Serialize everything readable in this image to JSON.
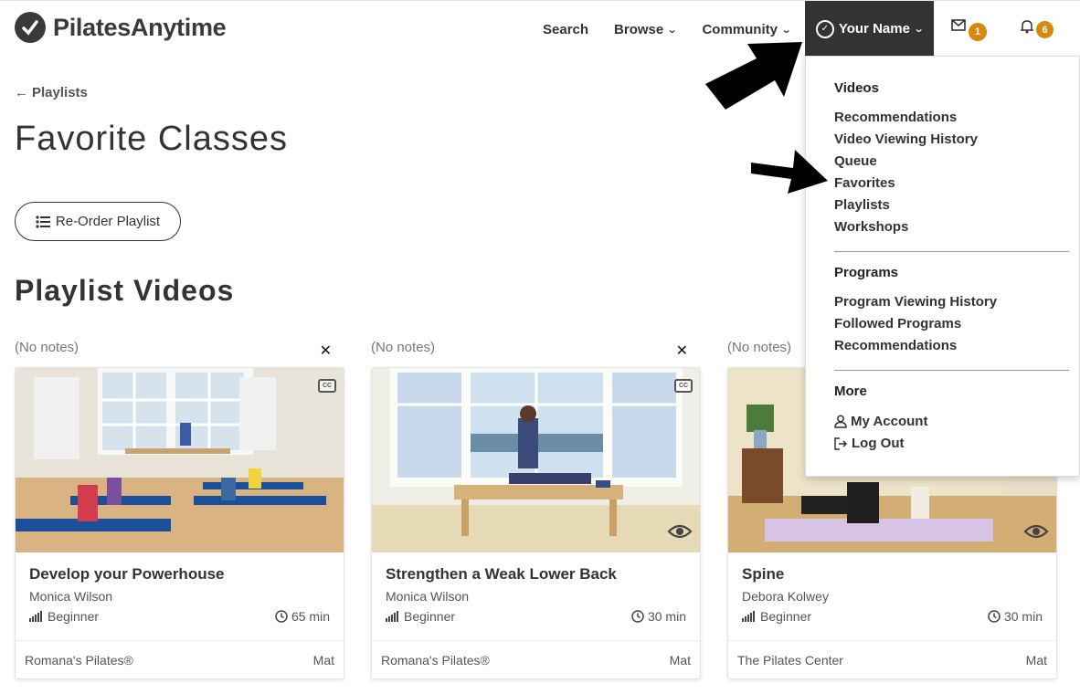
{
  "brand": {
    "name": "PilatesAnytime"
  },
  "nav": {
    "search": "Search",
    "browse": "Browse",
    "community": "Community",
    "user": "Your Name",
    "messages_count": "1",
    "notifications_count": "6"
  },
  "page": {
    "back_label": "Playlists",
    "title": "Favorite Classes",
    "reorder_label": "Re-Order Playlist",
    "section_title": "Playlist Videos"
  },
  "cards": [
    {
      "notes": "(No notes)",
      "title": "Develop your Powerhouse",
      "instructor": "Monica Wilson",
      "level": "Beginner",
      "duration": "65 min",
      "style": "Romana's Pilates®",
      "category": "Mat",
      "cc": "CC"
    },
    {
      "notes": "(No notes)",
      "title": "Strengthen a Weak Lower Back",
      "instructor": "Monica Wilson",
      "level": "Beginner",
      "duration": "30 min",
      "style": "Romana's Pilates®",
      "category": "Mat",
      "cc": "CC"
    },
    {
      "notes": "(No notes)",
      "title": "Spine",
      "instructor": "Debora Kolwey",
      "level": "Beginner",
      "duration": "30 min",
      "style": "The Pilates Center",
      "category": "Mat"
    }
  ],
  "dropdown": {
    "videos_heading": "Videos",
    "videos": [
      "Recommendations",
      "Video Viewing History",
      "Queue",
      "Favorites",
      "Playlists",
      "Workshops"
    ],
    "programs_heading": "Programs",
    "programs": [
      "Program Viewing History",
      "Followed Programs",
      "Recommendations"
    ],
    "more_heading": "More",
    "my_account": "My Account",
    "log_out": "Log Out"
  },
  "colors": {
    "badge": "#d6880f",
    "user_tab": "#333333"
  }
}
